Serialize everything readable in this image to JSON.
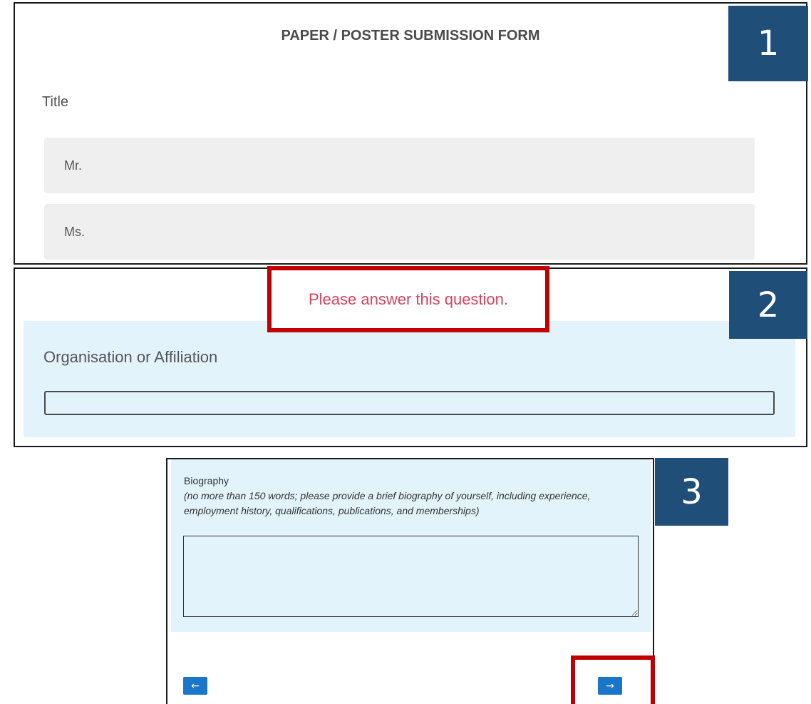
{
  "panel1": {
    "form_title": "PAPER / POSTER SUBMISSION FORM",
    "field_label": "Title",
    "options": [
      "Mr.",
      "Ms."
    ],
    "badge": "1"
  },
  "panel2": {
    "error_message": "Please answer this question.",
    "field_label": "Organisation or Affiliation",
    "input_value": "",
    "badge": "2"
  },
  "panel3": {
    "field_label": "Biography",
    "hint": "(no more than 150 words; please provide a brief biography of yourself, including experience, employment history, qualifications, publications, and memberships)",
    "textarea_value": "",
    "back_label": "←",
    "next_label": "→",
    "badge": "3"
  },
  "colors": {
    "badge_bg": "#1f4e79",
    "highlight": "#c00000",
    "error_text": "#d9425d",
    "field_bg": "#e2f3fc",
    "button_bg": "#1976c8"
  }
}
